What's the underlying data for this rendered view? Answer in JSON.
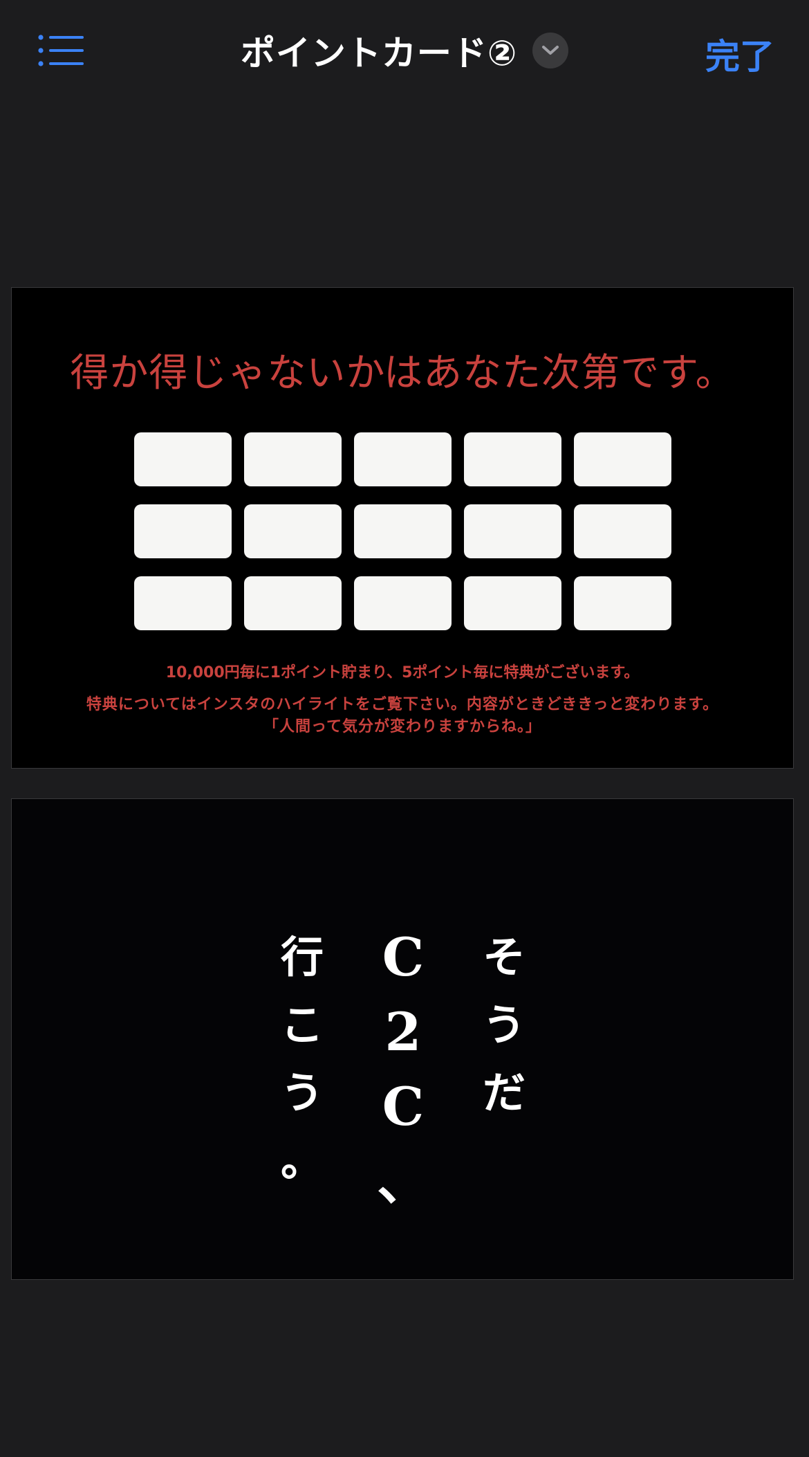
{
  "header": {
    "title": "ポイントカード②",
    "done_label": "完了",
    "menu_icon": "list-icon",
    "chevron_icon": "chevron-down-icon",
    "accent_color": "#3b82f6"
  },
  "slides": [
    {
      "heading": "得か得じゃないかはあなた次第です。",
      "stamp_rows": 3,
      "stamp_columns": 5,
      "note_1": "10,000円毎に1ポイント貯まり、5ポイント毎に特典がございます。",
      "note_2": "特典についてはインスタのハイライトをご覧下さい。内容がときどききっと変わります。",
      "note_3": "「人間って気分が変わりますからね。」",
      "text_color": "#c9423e"
    },
    {
      "column_right": "そうだ",
      "column_middle": "C2C、",
      "column_left": "行こう。"
    }
  ]
}
